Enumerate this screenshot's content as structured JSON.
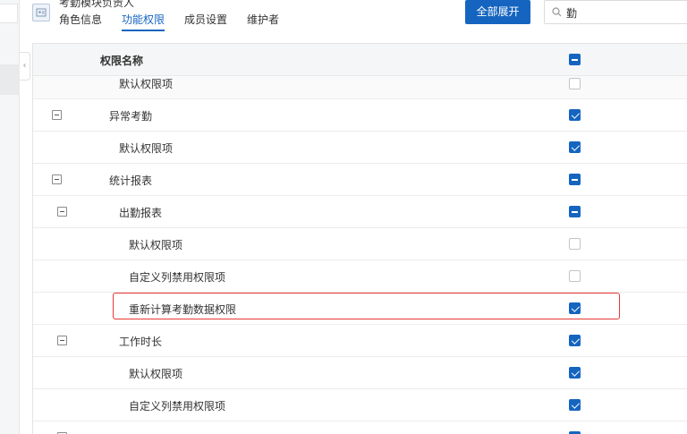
{
  "header": {
    "role_title": "考勤模块负责人",
    "tabs": [
      {
        "label": "角色信息",
        "active": false
      },
      {
        "label": "功能权限",
        "active": true
      },
      {
        "label": "成员设置",
        "active": false
      },
      {
        "label": "维护者",
        "active": false
      }
    ],
    "expand_all_label": "全部展开",
    "search_value": "勤",
    "accent_color": "#1565c0"
  },
  "table": {
    "column_header": "权限名称",
    "header_state": "indeterminate",
    "rows": [
      {
        "label": "默认权限项",
        "state": "unchecked",
        "has_toggle": false
      },
      {
        "label": "异常考勤",
        "state": "checked",
        "has_toggle": true
      },
      {
        "label": "默认权限项",
        "state": "checked",
        "has_toggle": false
      },
      {
        "label": "统计报表",
        "state": "indeterminate",
        "has_toggle": true
      },
      {
        "label": "出勤报表",
        "state": "indeterminate",
        "has_toggle": true
      },
      {
        "label": "默认权限项",
        "state": "unchecked",
        "has_toggle": false
      },
      {
        "label": "自定义列禁用权限项",
        "state": "unchecked",
        "has_toggle": false
      },
      {
        "label": "重新计算考勤数据权限",
        "state": "checked",
        "has_toggle": false,
        "highlighted": true
      },
      {
        "label": "工作时长",
        "state": "checked",
        "has_toggle": true
      },
      {
        "label": "默认权限项",
        "state": "checked",
        "has_toggle": false
      },
      {
        "label": "自定义列禁用权限项",
        "state": "checked",
        "has_toggle": false
      }
    ]
  }
}
